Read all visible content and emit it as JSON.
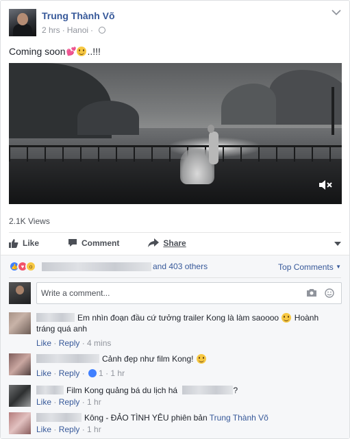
{
  "post": {
    "author": "Trung Thành Võ",
    "time": "2 hrs",
    "separator": "·",
    "location": "Hanoi",
    "text_before": "Coming soon",
    "text_after": "..!!!",
    "views": "2.1K Views"
  },
  "actions": {
    "like": "Like",
    "comment": "Comment",
    "share": "Share"
  },
  "reactions": {
    "others": "and 403 others",
    "sort": "Top Comments"
  },
  "composer": {
    "placeholder": "Write a comment..."
  },
  "comments": [
    {
      "text": "Em nhìn đoạn đầu cứ tưởng trailer Kong là làm saoooo",
      "text2": "Hoành tráng quá anh",
      "like": "Like",
      "reply": "Reply",
      "time": "4 mins"
    },
    {
      "text": "Cảnh đẹp như film Kong!",
      "like": "Like",
      "reply": "Reply",
      "likes": "1",
      "time": "1 hr"
    },
    {
      "text": "Film Kong quảng bá du lịch há",
      "text_end": "?",
      "like": "Like",
      "reply": "Reply",
      "time": "1 hr"
    },
    {
      "text": "Kông - ĐẢO TÌNH YÊU phiên bản",
      "mention": "Trung Thành Võ",
      "like": "Like",
      "reply": "Reply",
      "time": "1 hr"
    }
  ],
  "colors": {
    "link": "#365899",
    "meta": "#90949c",
    "like_blue": "#4080ff",
    "love_red": "#f25268"
  }
}
